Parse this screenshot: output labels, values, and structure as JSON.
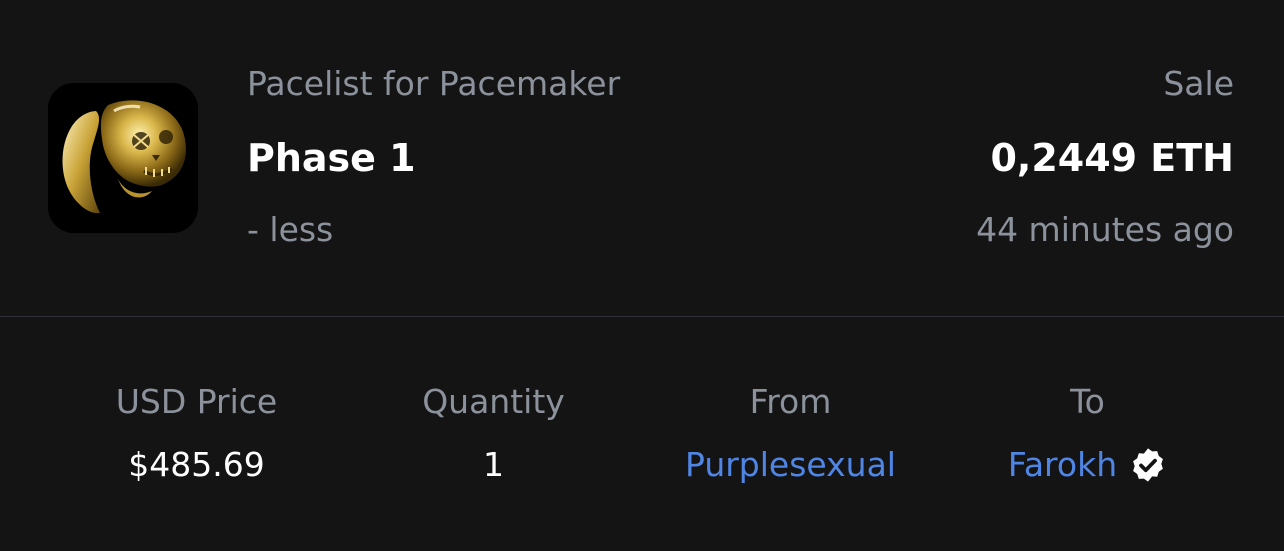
{
  "header": {
    "collection_name": "Pacelist for Pacemaker",
    "item_name": "Phase 1",
    "toggle_label": "- less",
    "sale_type": "Sale",
    "price": "0,2449 ETH",
    "time_ago": "44 minutes ago",
    "thumbnail_icon": "gold-skull-rabbit-image"
  },
  "stats": {
    "usd_price_label": "USD Price",
    "usd_price_value": "$485.69",
    "quantity_label": "Quantity",
    "quantity_value": "1",
    "from_label": "From",
    "from_value": "Purplesexual",
    "to_label": "To",
    "to_value": "Farokh",
    "to_badge_icon": "verified-badge-icon"
  },
  "colors": {
    "background": "#141415",
    "muted_text": "#8c929b",
    "primary_text": "#ffffff",
    "link": "#4f86e6",
    "divider": "#2f3033"
  }
}
